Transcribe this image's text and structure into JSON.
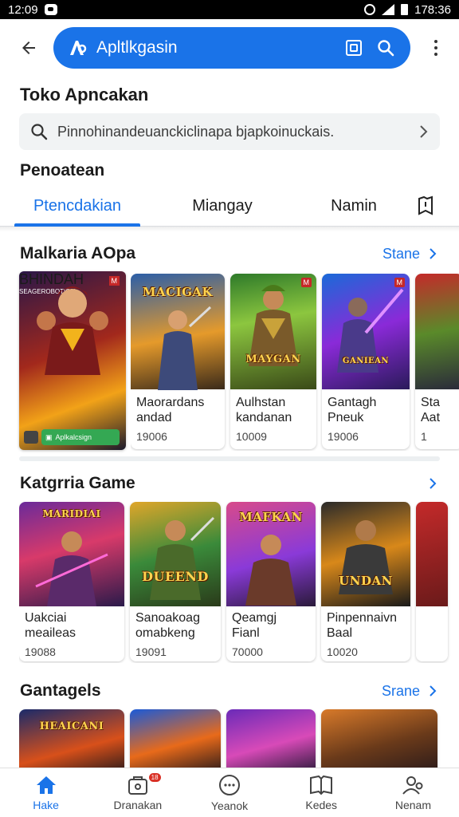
{
  "status_bar": {
    "time": "12:09",
    "right_time": "178:36"
  },
  "header": {
    "search_title": "Apltlkgasin"
  },
  "store": {
    "title": "Toko Apncakan",
    "search_query": "Pinnohinandeuanckiclinapa bjapkoinuckais.",
    "section_label": "Penoatean"
  },
  "tabs": [
    {
      "label": "Ptencdakian",
      "active": true
    },
    {
      "label": "Miangay",
      "active": false
    },
    {
      "label": "Namin",
      "active": false
    }
  ],
  "section1": {
    "title": "Malkaria AOpa",
    "more_label": "Stane",
    "featured": {
      "logo": "BHINDAH",
      "subtitle": "SEAGEROBOTION",
      "install_label": "Aplkalcsign"
    },
    "cards": [
      {
        "name": "Maorardans\nandad",
        "count": "19006",
        "logo": "MACIGAK",
        "badge": ""
      },
      {
        "name": "Aulhstan\nkandanan",
        "count": "10009",
        "logo": "MAYGAN",
        "badge": "xxx"
      },
      {
        "name": "Gantagh\nPneuk",
        "count": "19006",
        "logo": "GANIEAN",
        "badge": "xxx"
      },
      {
        "name": "Sta\nAat",
        "count": "1",
        "logo": "",
        "badge": ""
      }
    ]
  },
  "section2": {
    "title": "Katgrria Game",
    "more_label": "",
    "cards": [
      {
        "name": "Uakciai\nmeaileas",
        "count": "19088",
        "logo": "MARIDIAI",
        "badge": ""
      },
      {
        "name": "Sanoakoag\nomabkeng",
        "count": "19091",
        "logo": "DUEEND",
        "badge": ""
      },
      {
        "name": "Qeamgj\nFianl",
        "count": "70000",
        "logo": "MAFKAN",
        "badge": ""
      },
      {
        "name": "Pinpennaivn\nBaal",
        "count": "10020",
        "logo": "UNDAN",
        "badge": ""
      },
      {
        "name": "",
        "count": "",
        "logo": "",
        "badge": ""
      }
    ]
  },
  "section3": {
    "title": "Gantagels",
    "more_label": "Srane",
    "cards": [
      {
        "logo": "HEAICANI"
      },
      {
        "logo": ""
      },
      {
        "logo": ""
      },
      {
        "logo": ""
      }
    ]
  },
  "bottom_nav": [
    {
      "label": "Hake",
      "icon": "home-icon",
      "active": true,
      "badge": ""
    },
    {
      "label": "Dranakan",
      "icon": "apps-icon",
      "active": false,
      "badge": "18"
    },
    {
      "label": "Yeanok",
      "icon": "games-icon",
      "active": false,
      "badge": ""
    },
    {
      "label": "Kedes",
      "icon": "books-icon",
      "active": false,
      "badge": ""
    },
    {
      "label": "Nenam",
      "icon": "profile-icon",
      "active": false,
      "badge": ""
    }
  ],
  "colors": {
    "accent": "#1a73e8",
    "install_green": "#34a853",
    "badge_red": "#d93025"
  }
}
